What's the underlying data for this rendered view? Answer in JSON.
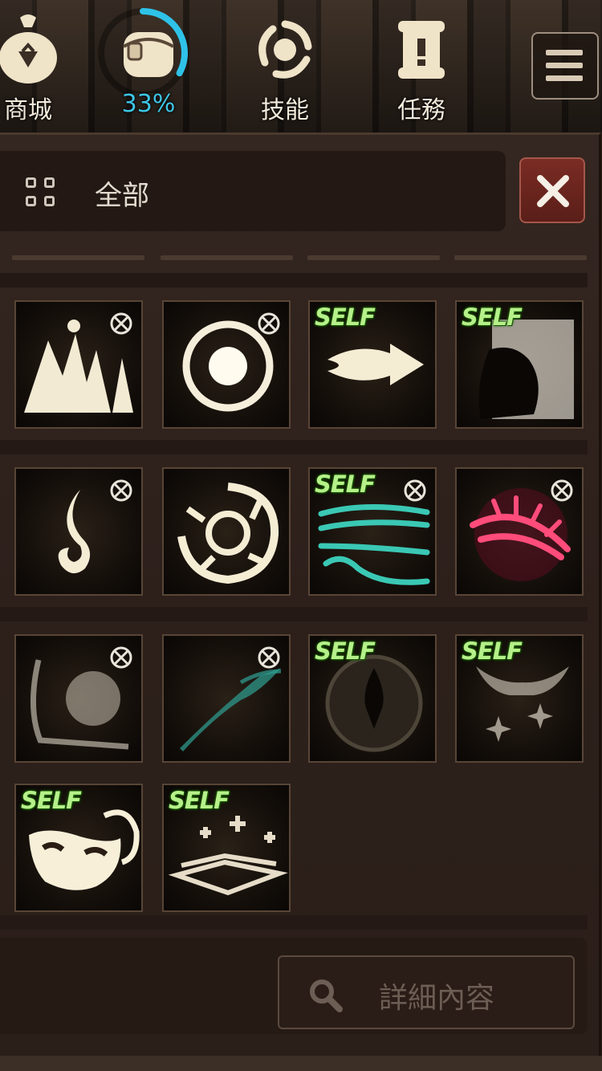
{
  "hud": {
    "shop_label": "商城",
    "bag_percent": "33%",
    "bag_progress": 0.33,
    "skills_label": "技能",
    "quests_label": "任務"
  },
  "filter": {
    "label": "全部"
  },
  "icons": {
    "filter": "grid-icon",
    "close": "close-icon",
    "search": "search-icon",
    "menu": "menu-icon"
  },
  "colors": {
    "accent": "#3ec6e6",
    "self_tag": "#b6f08a",
    "close": "#7a2c24"
  },
  "skills": [
    {
      "art": "mountains",
      "self": "",
      "lock": true
    },
    {
      "art": "ring",
      "self": "",
      "lock": true
    },
    {
      "art": "arrows",
      "self": "SELF",
      "lock": false
    },
    {
      "art": "shadow-head",
      "self": "SELF",
      "lock": false
    },
    {
      "art": "flame",
      "self": "",
      "lock": true
    },
    {
      "art": "vortex",
      "self": "",
      "lock": false
    },
    {
      "art": "wind",
      "self": "SELF",
      "lock": true
    },
    {
      "art": "red-claw",
      "self": "",
      "lock": true
    },
    {
      "art": "curved-blade",
      "self": "",
      "lock": true
    },
    {
      "art": "teal-slash",
      "self": "",
      "lock": true
    },
    {
      "art": "shield-drop",
      "self": "SELF",
      "lock": false
    },
    {
      "art": "hands-sparkle",
      "self": "SELF",
      "lock": false
    },
    {
      "art": "mask",
      "self": "SELF",
      "lock": false
    },
    {
      "art": "book",
      "self": "SELF",
      "lock": false
    }
  ],
  "bottom": {
    "detail_label": "詳細內容"
  }
}
